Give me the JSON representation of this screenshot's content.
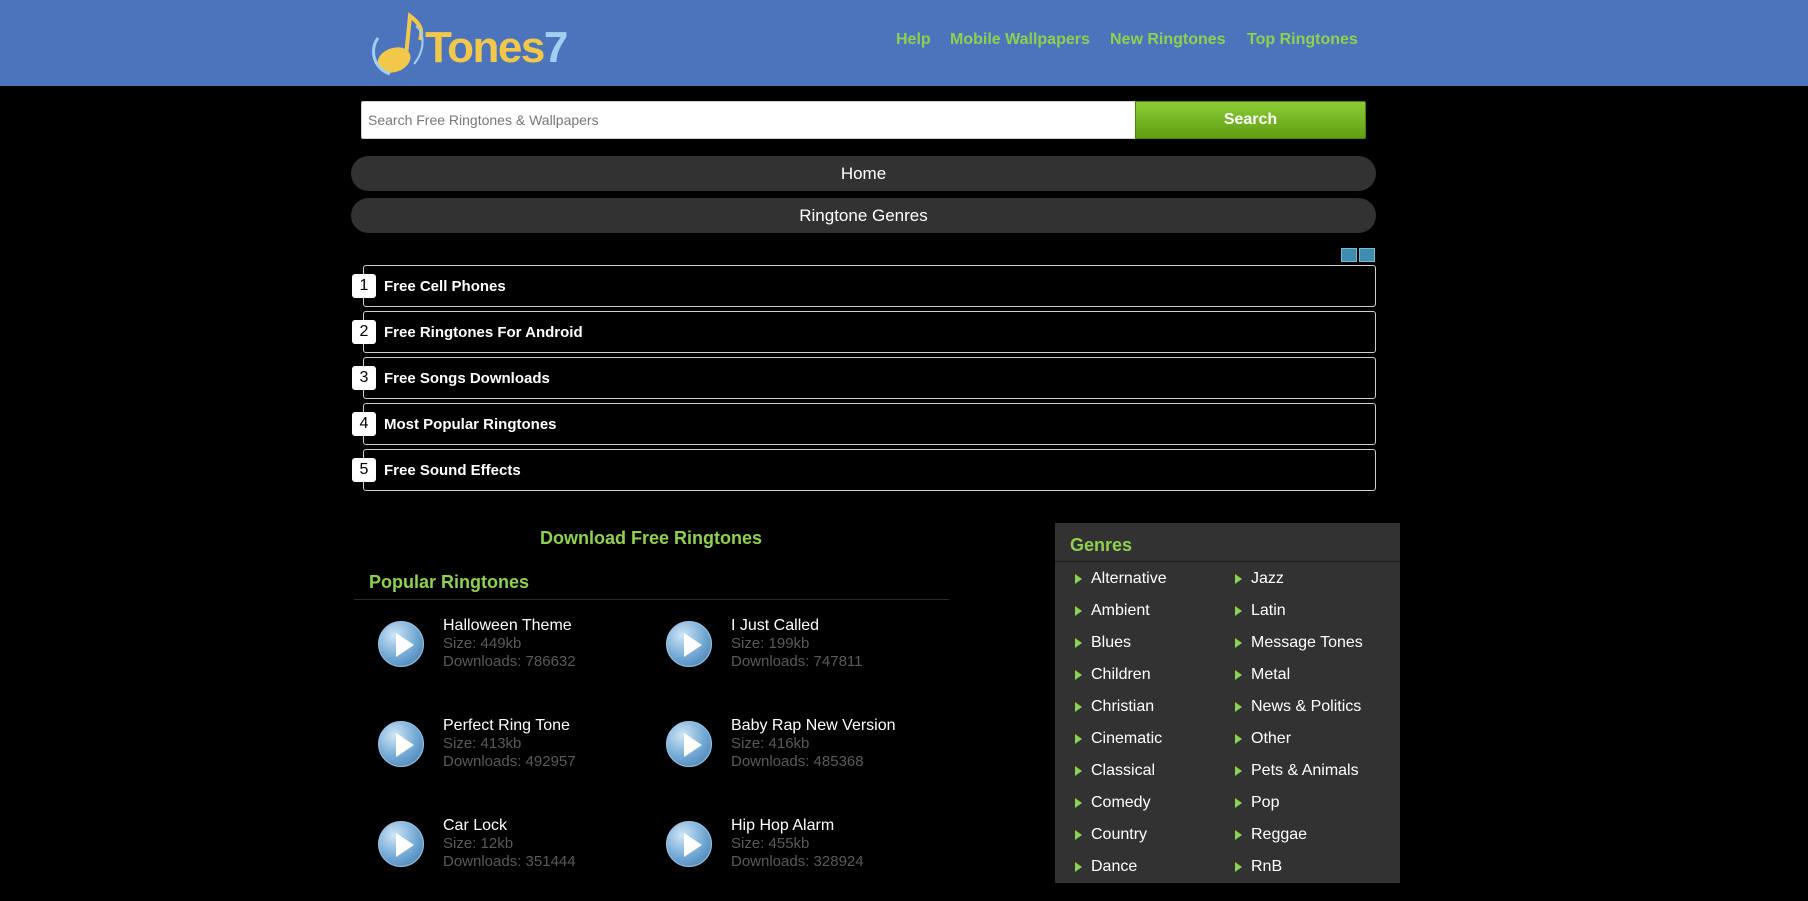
{
  "header": {
    "logo_text": "Tones",
    "logo_number": "7",
    "nav": [
      "Help",
      "Mobile Wallpapers",
      "New Ringtones",
      "Top Ringtones"
    ]
  },
  "search": {
    "placeholder": "Search Free Ringtones & Wallpapers",
    "button_label": "Search"
  },
  "menu": {
    "home": "Home",
    "genres": "Ringtone Genres"
  },
  "ranked_links": [
    {
      "num": "1",
      "label": "Free Cell Phones"
    },
    {
      "num": "2",
      "label": "Free Ringtones For Android"
    },
    {
      "num": "3",
      "label": "Free Songs Downloads"
    },
    {
      "num": "4",
      "label": "Most Popular Ringtones"
    },
    {
      "num": "5",
      "label": "Free Sound Effects"
    }
  ],
  "main": {
    "download_title": "Download Free Ringtones",
    "popular_title": "Popular Ringtones",
    "tones": [
      {
        "name": "Halloween Theme",
        "size": "Size: 449kb",
        "downloads": "Downloads: 786632"
      },
      {
        "name": "I Just Called",
        "size": "Size: 199kb",
        "downloads": "Downloads: 747811"
      },
      {
        "name": "Perfect Ring Tone",
        "size": "Size: 413kb",
        "downloads": "Downloads: 492957"
      },
      {
        "name": "Baby Rap New Version",
        "size": "Size: 416kb",
        "downloads": "Downloads: 485368"
      },
      {
        "name": "Car Lock",
        "size": "Size: 12kb",
        "downloads": "Downloads: 351444"
      },
      {
        "name": "Hip Hop Alarm",
        "size": "Size: 455kb",
        "downloads": "Downloads: 328924"
      }
    ]
  },
  "sidebar": {
    "title": "Genres",
    "left": [
      "Alternative",
      "Ambient",
      "Blues",
      "Children",
      "Christian",
      "Cinematic",
      "Classical",
      "Comedy",
      "Country",
      "Dance"
    ],
    "right": [
      "Jazz",
      "Latin",
      "Message Tones",
      "Metal",
      "News & Politics",
      "Other",
      "Pets & Animals",
      "Pop",
      "Reggae",
      "RnB"
    ]
  },
  "colors": {
    "header_bg": "#4c74bd",
    "accent_green": "#8fd14f",
    "pill_bg": "#323232"
  }
}
